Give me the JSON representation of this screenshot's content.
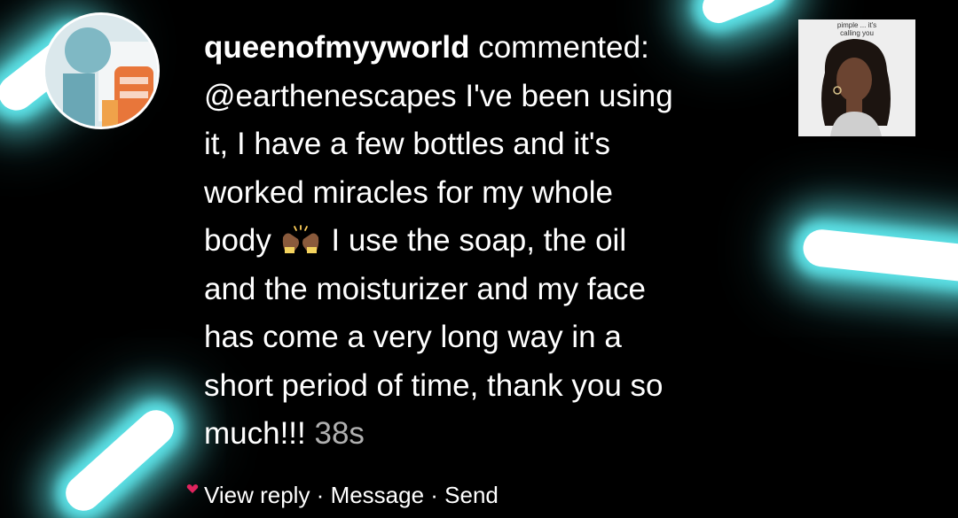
{
  "comment": {
    "username": "queenofmyyworld",
    "action": "commented:",
    "mention": "@earthenescapes",
    "line1_rest": "I've been using",
    "line2": "it, I have a few bottles and it's",
    "line3": "worked miracles for my whole",
    "line4_before_emoji": "body",
    "emoji": "raising-hands-emoji",
    "line4_after_emoji": "I use the soap, the oil",
    "line5": "and the moisturizer and my face",
    "line6": "has come a very long way in a",
    "line7": "short period of time, thank you so",
    "line8": "much!!!",
    "timestamp": "38s"
  },
  "thumbnail": {
    "caption_top": "pimple ... it's",
    "caption_bottom": "calling you"
  },
  "actions": {
    "reply_row_text": "View reply · Message · Send"
  },
  "colors": {
    "background": "#000000",
    "glow": "#5ce1e6",
    "text": "#ffffff",
    "timestamp": "#b0b0b0"
  }
}
